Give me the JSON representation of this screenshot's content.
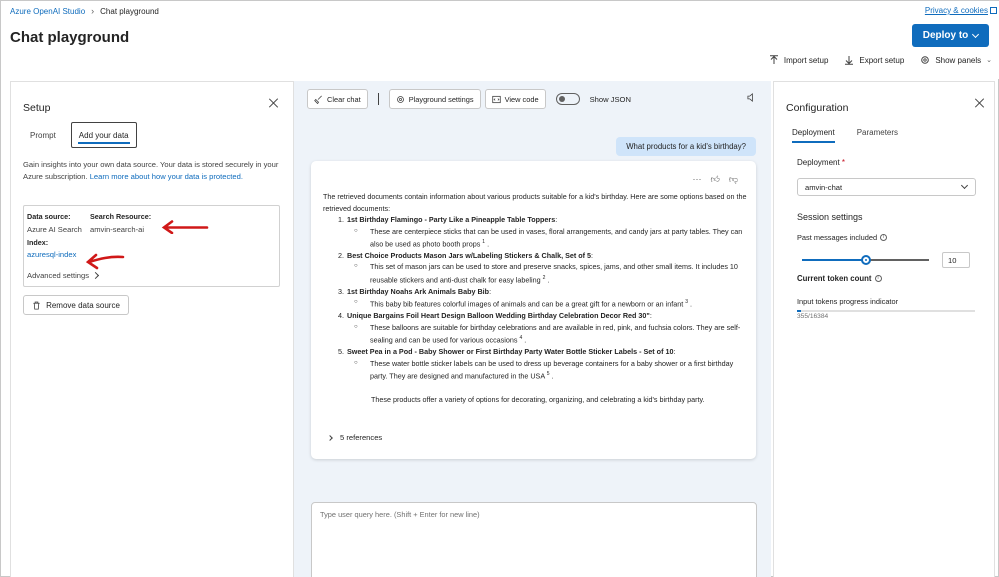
{
  "header": {
    "breadcrumbs": [
      "Azure OpenAI Studio",
      "Chat playground"
    ],
    "privacy_label": "Privacy & cookies",
    "title": "Chat playground",
    "deploy_label": "Deploy to",
    "actions": {
      "import_label": "Import setup",
      "export_label": "Export setup",
      "panels_label": "Show panels"
    }
  },
  "setup": {
    "title": "Setup",
    "tabs": [
      "Prompt",
      "Add your data"
    ],
    "active_tab": "Add your data",
    "description": "Gain insights into your own data source. Your data is stored securely in your Azure subscription.",
    "learn_more": "Learn more about how your data is protected.",
    "datasource": {
      "source_label": "Data source:",
      "source_value": "Azure AI Search",
      "resource_label": "Search Resource:",
      "resource_value": "amvin-search-ai",
      "index_label": "Index:",
      "index_value": "azuresql-index",
      "advanced_label": "Advanced settings"
    },
    "remove_label": "Remove data source"
  },
  "chat": {
    "toolbar": {
      "clear_label": "Clear chat",
      "settings_label": "Playground settings",
      "code_label": "View code",
      "json_label": "Show JSON",
      "json_on": false
    },
    "user_message": "What products for a kid's birthday?",
    "answer": {
      "intro": "The retrieved documents contain information about various products suitable for a kid's birthday. Here are some options based on the retrieved documents:",
      "items": [
        {
          "name": "1st Birthday Flamingo - Party Like a Pineapple Table Toppers",
          "detail": "These are centerpiece sticks that can be used in vases, floral arrangements, and candy jars at party tables. They can also be used as photo booth props",
          "ref": "1"
        },
        {
          "name": "Best Choice Products Mason Jars w/Labeling Stickers & Chalk, Set of 5",
          "detail": "This set of mason jars can be used to store and preserve snacks, spices, jams, and other small items. It includes 10 reusable stickers and anti-dust chalk for easy labeling",
          "ref": "2"
        },
        {
          "name": "1st Birthday Noahs Ark Animals Baby Bib",
          "detail": "This baby bib features colorful images of animals and can be a great gift for a newborn or an infant",
          "ref": "3"
        },
        {
          "name": "Unique Bargains Foil Heart Design Balloon Wedding Birthday Celebration Decor Red 30\"",
          "detail": "These balloons are suitable for birthday celebrations and are available in red, pink, and fuchsia colors. They are self-sealing and can be used for various occasions",
          "ref": "4"
        },
        {
          "name": "Sweet Pea in a Pod - Baby Shower or First Birthday Party Water Bottle Sticker Labels - Set of 10",
          "detail": "These water bottle sticker labels can be used to dress up beverage containers for a baby shower or a first birthday party. They are designed and manufactured in the USA",
          "ref": "5"
        }
      ],
      "summary": "These products offer a variety of options for decorating, organizing, and celebrating a kid's birthday party.",
      "references_label": "5 references"
    },
    "input_placeholder": "Type user query here. (Shift + Enter for new line)"
  },
  "config": {
    "title": "Configuration",
    "tabs": [
      "Deployment",
      "Parameters"
    ],
    "active_tab": "Deployment",
    "deployment_label": "Deployment",
    "deployment_value": "amvin-chat",
    "session_title": "Session settings",
    "past_messages_label": "Past messages included",
    "past_messages_value": "10",
    "past_messages_fraction": 0.5,
    "token_count_label": "Current token count",
    "progress_label": "Input tokens progress indicator",
    "tokens_value": "355/16384",
    "tokens_fraction": 0.0217
  },
  "colors": {
    "accent": "#0f6cbd",
    "annotation": "#d01818",
    "user_bubble": "#cfe4fa"
  }
}
